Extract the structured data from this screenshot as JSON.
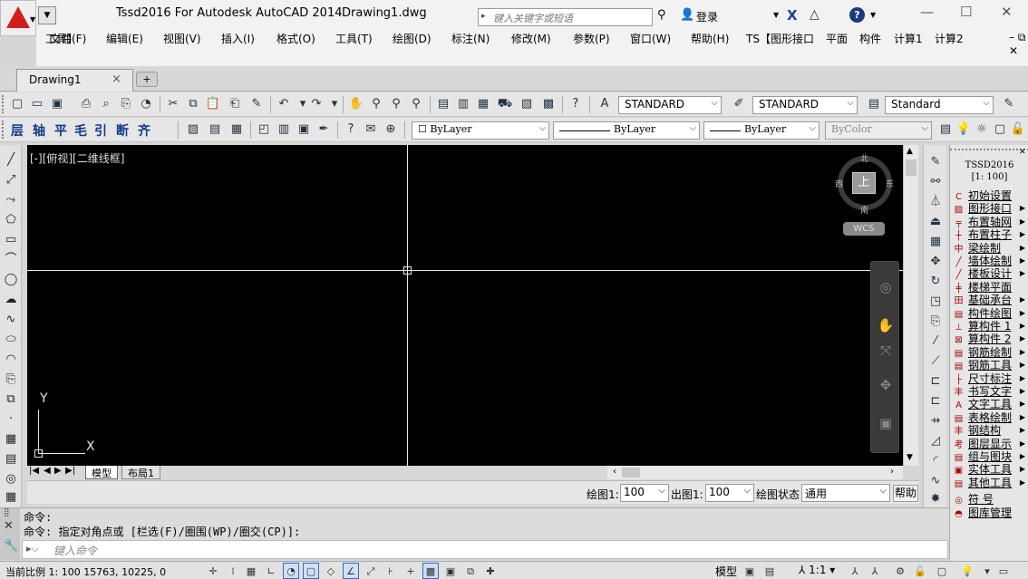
{
  "titlebar": {
    "app_title": "Tssd2016 For Autodesk AutoCAD 2014",
    "doc_title": "Drawing1.dwg",
    "search_placeholder": "键入关键字或短语",
    "login": "登录",
    "help_label": "?"
  },
  "menu": {
    "items": [
      "文件(F)",
      "编辑(E)",
      "视图(V)",
      "插入(I)",
      "格式(O)",
      "工具(T)",
      "绘图(D)",
      "标注(N)",
      "修改(M)",
      "参数(P)",
      "窗口(W)",
      "帮助(H)",
      "TS【图形接口",
      "平面",
      "构件",
      "计算1",
      "计算2"
    ],
    "extra": "工具】"
  },
  "tabs": {
    "doc_tab": "Drawing1"
  },
  "toolbar1": {
    "text_style": "STANDARD",
    "dim_style": "STANDARD",
    "table_style": "Standard"
  },
  "toolbar2": {
    "ts_buttons": [
      "层",
      "轴",
      "平",
      "毛",
      "引",
      "断",
      "齐"
    ],
    "layer": "ByLayer",
    "linetype": "ByLayer",
    "lineweight": "ByLayer",
    "color": "ByColor"
  },
  "canvas": {
    "view_label": "[-][俯视][二维线框]",
    "ucs_y": "Y",
    "ucs_x": "X",
    "viewcube": {
      "north": "北",
      "south": "南",
      "east": "东",
      "west": "西",
      "top": "上"
    },
    "wcs": "WCS"
  },
  "layout_tabs": {
    "model": "模型",
    "layout1": "布局1"
  },
  "scalebar": {
    "draw_scale_label": "绘图1:",
    "draw_scale_value": "100",
    "out_scale_label": "出图1:",
    "out_scale_value": "100",
    "state_label": "绘图状态",
    "state_value": "通用",
    "help": "帮助"
  },
  "command": {
    "line1": "命令:",
    "line2": "命令: 指定对角点或 [栏选(F)/圈围(WP)/圈交(CP)]:",
    "placeholder": "键入命令"
  },
  "statusbar": {
    "coords": "当前比例 1: 100  15763, 10225, 0",
    "model": "模型",
    "anno_scale": "1:1"
  },
  "tssd_panel": {
    "title": "TSSD2016",
    "scale": "[1: 100]",
    "items": [
      "初始设置",
      "图形接口",
      "布置轴网",
      "布置柱子",
      "梁绘制",
      "墙体绘制",
      "楼板设计",
      "楼梯平面",
      "基础承台",
      "构件绘图",
      "算构件 1",
      "算构件 2",
      "钢筋绘制",
      "钢筋工具",
      "尺寸标注",
      "书写文字",
      "文字工具",
      "表格绘制",
      "钢结构",
      "图层显示",
      "组与图块",
      "实体工具",
      "其他工具",
      "符 号",
      "图库管理"
    ]
  },
  "colors": {
    "canvas": "#000000",
    "logo": "#d11d1d",
    "panel": "#e6e6e6"
  }
}
